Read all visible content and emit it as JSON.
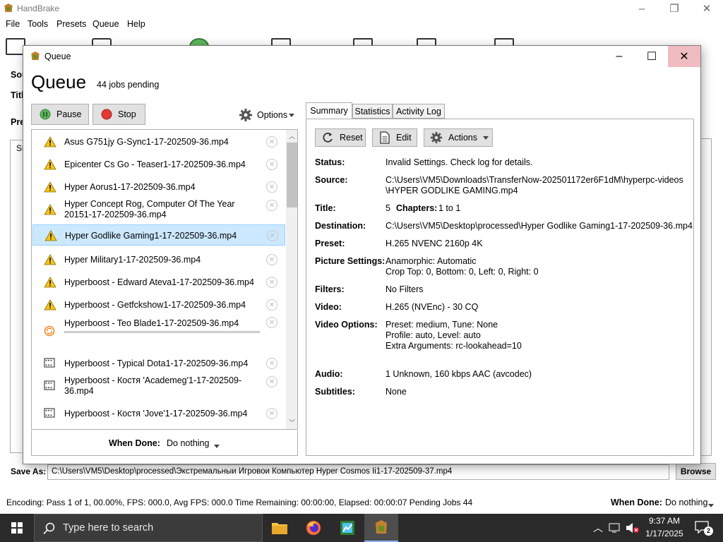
{
  "main_window": {
    "title": "HandBrake",
    "menu": [
      "File",
      "Tools",
      "Presets",
      "Queue",
      "Help"
    ],
    "save_as_label": "Save As:",
    "save_as_value": "C:\\Users\\VM5\\Desktop\\processed\\Экстремальныи Игровои Компьютер Hyper Cosmos Ii1-17-202509-37.mp4",
    "browse_label": "Browse",
    "status_text": "Encoding: Pass 1 of 1,  00.00%, FPS: 000.0,  Avg FPS: 000.0 Time Remaining: 00:00:00,  Elapsed: 00:00:07    Pending Jobs 44",
    "when_done_label": "When Done:",
    "when_done_value": "Do nothing",
    "left_labels": [
      "Sou",
      "Titl",
      "Pre",
      "Su"
    ]
  },
  "queue_dialog": {
    "title": "Queue",
    "header": "Queue",
    "pending": "44 jobs pending",
    "pause_label": "Pause",
    "stop_label": "Stop",
    "options_label": "Options",
    "when_done_label": "When Done:",
    "when_done_value": "Do nothing",
    "jobs": [
      {
        "name": "Asus G751jy G-Sync1-17-202509-36.mp4",
        "status": "warning"
      },
      {
        "name": "Epicenter  Cs Go - Teaser1-17-202509-36.mp4",
        "status": "warning"
      },
      {
        "name": "Hyper Aorus1-17-202509-36.mp4",
        "status": "warning"
      },
      {
        "name": "Hyper Concept Rog, Computer Of The Year 20151-17-202509-36.mp4",
        "status": "warning"
      },
      {
        "name": "Hyper Godlike Gaming1-17-202509-36.mp4",
        "status": "warning",
        "selected": true
      },
      {
        "name": "Hyper Military1-17-202509-36.mp4",
        "status": "warning"
      },
      {
        "name": "Hyperboost - Edward Ateva1-17-202509-36.mp4",
        "status": "warning"
      },
      {
        "name": "Hyperboost - Getfckshow1-17-202509-36.mp4",
        "status": "warning"
      },
      {
        "name": "Hyperboost - Teo Blade1-17-202509-36.mp4",
        "status": "encoding",
        "progress": 0
      },
      {
        "name": "Hyperboost - Typical Dota1-17-202509-36.mp4",
        "status": "queued"
      },
      {
        "name": "Hyperboost - Костя 'Academeg'1-17-202509-36.mp4",
        "status": "queued"
      },
      {
        "name": "Hyperboost - Костя 'Jove'1-17-202509-36.mp4",
        "status": "queued"
      }
    ],
    "tabs": [
      "Summary",
      "Statistics",
      "Activity Log"
    ],
    "reset_label": "Reset",
    "edit_label": "Edit",
    "actions_label": "Actions",
    "summary": {
      "status_k": "Status:",
      "status_v": "Invalid Settings. Check log for details.",
      "source_k": "Source:",
      "source_v1": "C:\\Users\\VM5\\Downloads\\TransferNow-202501172er6F1dM\\hyperpc-videos",
      "source_v2": "\\HYPER GODLIKE GAMING.mp4",
      "title_k": "Title:",
      "title_num": "5",
      "chapters_k": "Chapters:",
      "chapters_v": "1  to  1",
      "dest_k": "Destination:",
      "dest_v": "C:\\Users\\VM5\\Desktop\\processed\\Hyper Godlike Gaming1-17-202509-36.mp4",
      "preset_k": "Preset:",
      "preset_v": "H.265 NVENC 2160p 4K",
      "pic_k": "Picture Settings:",
      "pic_v1": "Anamorphic: Automatic",
      "pic_v2": "Crop Top: 0, Bottom: 0, Left: 0, Right: 0",
      "filters_k": "Filters:",
      "filters_v": "No Filters",
      "video_k": "Video:",
      "video_v": "H.265 (NVEnc) - 30 CQ",
      "vopt_k": "Video Options:",
      "vopt_v1": "Preset: medium, Tune: None",
      "vopt_v2": "Profile: auto, Level: auto",
      "vopt_v3": "Extra Arguments: rc-lookahead=10",
      "audio_k": "Audio:",
      "audio_v": "1 Unknown, 160 kbps AAC (avcodec)",
      "subs_k": "Subtitles:",
      "subs_v": "None"
    }
  },
  "taskbar": {
    "search_placeholder": "Type here to search",
    "time": "9:37 AM",
    "date": "1/17/2025",
    "notification_count": "2"
  },
  "colors": {
    "warning": "#f5c518",
    "selected": "#cce8ff",
    "close_hover": "#e81123",
    "taskbar": "#2b2b2b"
  }
}
